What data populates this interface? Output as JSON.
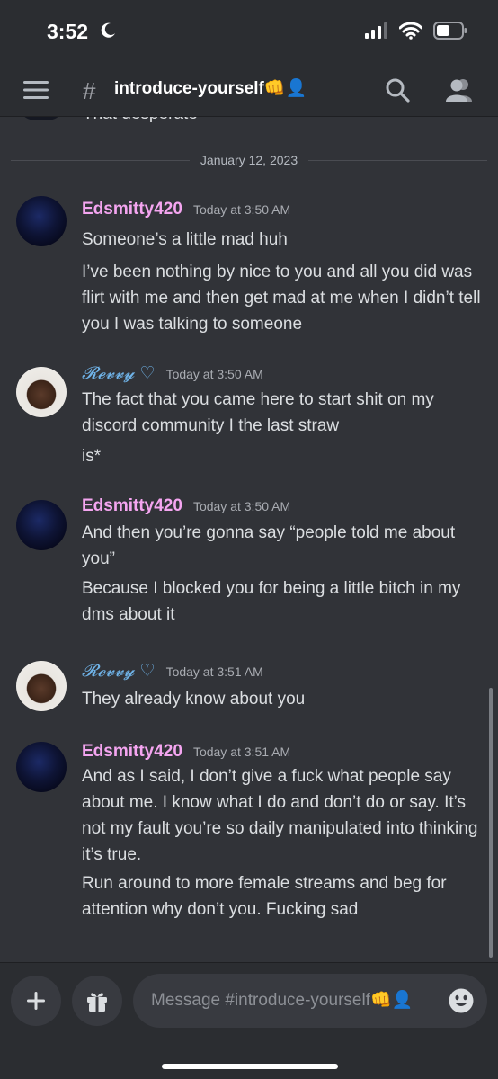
{
  "status_bar": {
    "time": "3:52",
    "icons": [
      "moon-icon",
      "signal-icon",
      "wifi-icon",
      "battery-icon"
    ]
  },
  "header": {
    "hash": "#",
    "channel_name": "introduce-yourself👊👤",
    "icons": [
      "hamburger-menu-icon",
      "search-icon",
      "members-icon"
    ]
  },
  "chat": {
    "cutoff_text": "That desperate",
    "date_divider": "January 12, 2023",
    "messages": [
      {
        "author": "Edsmitty420",
        "timestamp": "Today at 3:50 AM",
        "lines": [
          "Someone’s a little mad huh",
          "I’ve been nothing by nice to you and all you did was flirt with me and then get mad at me when I didn’t tell you I was talking to someone"
        ]
      },
      {
        "author": "𝓡𝓮𝓿𝓿𝔂",
        "heart": "♡",
        "timestamp": "Today at 3:50 AM",
        "lines": [
          "The fact that you came here to start shit on my discord community I the last straw",
          "is*"
        ]
      },
      {
        "author": "Edsmitty420",
        "timestamp": "Today at 3:50 AM",
        "lines": [
          "And then you’re gonna say “people told me about you”",
          "Because I blocked you for being a little bitch in my dms about it"
        ]
      },
      {
        "author": "𝓡𝓮𝓿𝓿𝔂",
        "heart": "♡",
        "timestamp": "Today at 3:51 AM",
        "lines": [
          "They  already know about you"
        ]
      },
      {
        "author": "Edsmitty420",
        "timestamp": "Today at 3:51 AM",
        "lines": [
          "And as I said, I don’t give a fuck what people say about me. I know what I do and don’t do or say. It’s not my fault you’re so daily manipulated into thinking it’s true.",
          "Run around to more female streams and beg for attention why don’t you. Fucking sad"
        ]
      }
    ]
  },
  "input": {
    "placeholder": "Message #introduce-yourself👊👤",
    "icons": [
      "plus-icon",
      "gift-icon",
      "emoji-icon"
    ]
  },
  "colors": {
    "background": "#313338",
    "header": "#2b2d31",
    "edsmitty_name": "#f4a5f0",
    "revvy_name": "#6fb3e8",
    "text": "#dbdee1",
    "timestamp": "#a9acb2"
  }
}
